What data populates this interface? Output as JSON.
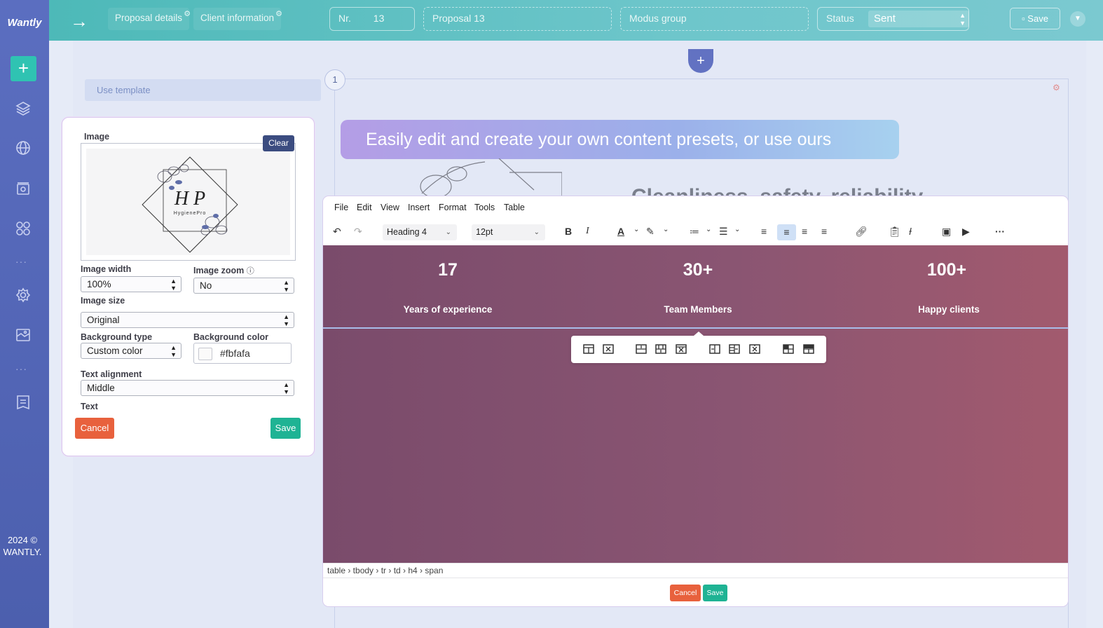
{
  "app": {
    "logo": "Wantly",
    "copyright": "2024 © WANTLY."
  },
  "sidebar": {
    "items": [
      {
        "icon": "plus-icon"
      },
      {
        "icon": "layers-icon"
      },
      {
        "icon": "globe-icon"
      },
      {
        "icon": "image-gallery-icon"
      },
      {
        "icon": "apps-grid-icon"
      },
      {
        "icon": "more-dots-icon",
        "label": "···"
      },
      {
        "icon": "gear-icon"
      },
      {
        "icon": "media-icon"
      },
      {
        "icon": "more-dots-icon",
        "label": "···"
      },
      {
        "icon": "document-list-icon"
      }
    ]
  },
  "topbar": {
    "arrow": "→",
    "tabs": [
      "Proposal details",
      "Client information"
    ],
    "number_label": "Nr.",
    "number_value": "13",
    "proposal_name": "Proposal 13",
    "client": "Modus group",
    "status_label": "Status",
    "status_value": "Sent",
    "save_label": "Save"
  },
  "canvas": {
    "use_template": "Use template",
    "section_number": "1",
    "banner": "Easily edit and create your own content presets, or use ours",
    "ghost_heading": "Cleanliness, safety, reliability"
  },
  "image_panel": {
    "image_label": "Image",
    "clear_label": "Clear",
    "logo_text": "H P",
    "logo_sub": "HygienePro",
    "image_width_label": "Image width",
    "image_width_value": "100%",
    "image_zoom_label": "Image zoom",
    "image_zoom_value": "No",
    "image_size_label": "Image size",
    "image_size_value": "Original",
    "background_type_label": "Background type",
    "background_type_value": "Custom color",
    "background_color_label": "Background color",
    "background_color_value": "#fbfafa",
    "text_alignment_label": "Text alignment",
    "text_alignment_value": "Middle",
    "text_label": "Text",
    "cancel_label": "Cancel",
    "save_label": "Save"
  },
  "editor": {
    "menu": [
      "File",
      "Edit",
      "View",
      "Insert",
      "Format",
      "Tools",
      "Table"
    ],
    "block_format": "Heading 4",
    "font_size": "12pt",
    "stats": [
      {
        "number": "17",
        "label": "Years of experience"
      },
      {
        "number": "30+",
        "label": "Team Members"
      },
      {
        "number": "100+",
        "label": "Happy clients"
      }
    ],
    "path": "table › tbody › tr › td › h4 › span",
    "cancel_label": "Cancel",
    "save_label": "Save"
  },
  "colors": {
    "sidebar": "#5b6ec0",
    "accent": "#2fc3b2",
    "cancel": "#e8613d",
    "save": "#1fb394",
    "content_bg": "#8a5572"
  }
}
